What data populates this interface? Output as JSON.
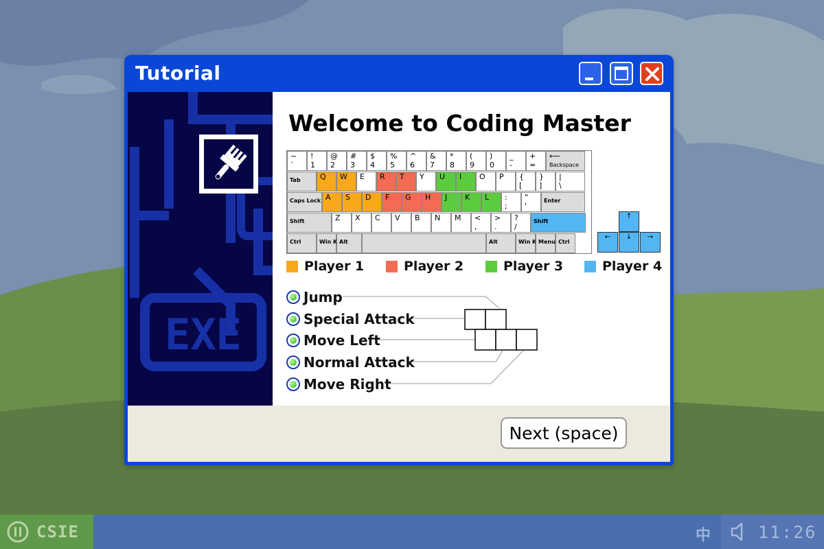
{
  "window": {
    "title": "Tutorial"
  },
  "heading": "Welcome to Coding Master",
  "keyboard": {
    "rows": [
      [
        {
          "top": "~",
          "bottom": "`"
        },
        {
          "top": "!",
          "bottom": "1"
        },
        {
          "top": "@",
          "bottom": "2"
        },
        {
          "top": "#",
          "bottom": "3"
        },
        {
          "top": "$",
          "bottom": "4"
        },
        {
          "top": "%",
          "bottom": "5"
        },
        {
          "top": "^",
          "bottom": "6"
        },
        {
          "top": "&",
          "bottom": "7"
        },
        {
          "top": "*",
          "bottom": "8"
        },
        {
          "top": "(",
          "bottom": "9"
        },
        {
          "top": ")",
          "bottom": "0"
        },
        {
          "top": "_",
          "bottom": "-"
        },
        {
          "top": "+",
          "bottom": "="
        },
        {
          "top": "⟵",
          "bottom": "Backspace"
        }
      ],
      [
        {
          "label": "Tab"
        },
        {
          "top": "Q",
          "player": 1
        },
        {
          "top": "W",
          "player": 1
        },
        {
          "top": "E"
        },
        {
          "top": "R",
          "player": 2
        },
        {
          "top": "T",
          "player": 2
        },
        {
          "top": "Y"
        },
        {
          "top": "U",
          "player": 3
        },
        {
          "top": "I",
          "player": 3
        },
        {
          "top": "O"
        },
        {
          "top": "P"
        },
        {
          "top": "{",
          "bottom": "["
        },
        {
          "top": "}",
          "bottom": "]"
        },
        {
          "top": "|",
          "bottom": "\\"
        }
      ],
      [
        {
          "label": "Caps Lock"
        },
        {
          "top": "A",
          "player": 1
        },
        {
          "top": "S",
          "player": 1
        },
        {
          "top": "D",
          "player": 1
        },
        {
          "top": "F",
          "player": 2
        },
        {
          "top": "G",
          "player": 2
        },
        {
          "top": "H",
          "player": 2
        },
        {
          "top": "J",
          "player": 3
        },
        {
          "top": "K",
          "player": 3
        },
        {
          "top": "L",
          "player": 3
        },
        {
          "top": ":",
          "bottom": ";"
        },
        {
          "top": "\"",
          "bottom": "'"
        },
        {
          "label": "Enter"
        }
      ],
      [
        {
          "label": "Shift"
        },
        {
          "top": "Z"
        },
        {
          "top": "X"
        },
        {
          "top": "C"
        },
        {
          "top": "V"
        },
        {
          "top": "B"
        },
        {
          "top": "N"
        },
        {
          "top": "M"
        },
        {
          "top": "<",
          "bottom": ","
        },
        {
          "top": ">",
          "bottom": "."
        },
        {
          "top": "?",
          "bottom": "/"
        },
        {
          "label": "Shift",
          "player": 4
        }
      ],
      [
        {
          "label": "Ctrl"
        },
        {
          "label": "Win Key"
        },
        {
          "label": "Alt"
        },
        {
          "label": ""
        },
        {
          "label": "Alt"
        },
        {
          "label": "Win Key"
        },
        {
          "label": "Menu"
        },
        {
          "label": "Ctrl"
        }
      ]
    ],
    "arrows": [
      "↑",
      "←",
      "↓",
      "→"
    ]
  },
  "legend": [
    {
      "label": "Player 1",
      "color": "#f7a81b"
    },
    {
      "label": "Player 2",
      "color": "#f26b52"
    },
    {
      "label": "Player 3",
      "color": "#5ccc3e"
    },
    {
      "label": "Player 4",
      "color": "#52b6f2"
    }
  ],
  "controls": [
    "Jump",
    "Special Attack",
    "Move Left",
    "Normal Attack",
    "Move Right"
  ],
  "next_button": "Next (space)",
  "side_panel": {
    "decor_text": "EXE"
  },
  "taskbar": {
    "start_label": "CSIE",
    "ime": "中",
    "clock": "11:26"
  }
}
